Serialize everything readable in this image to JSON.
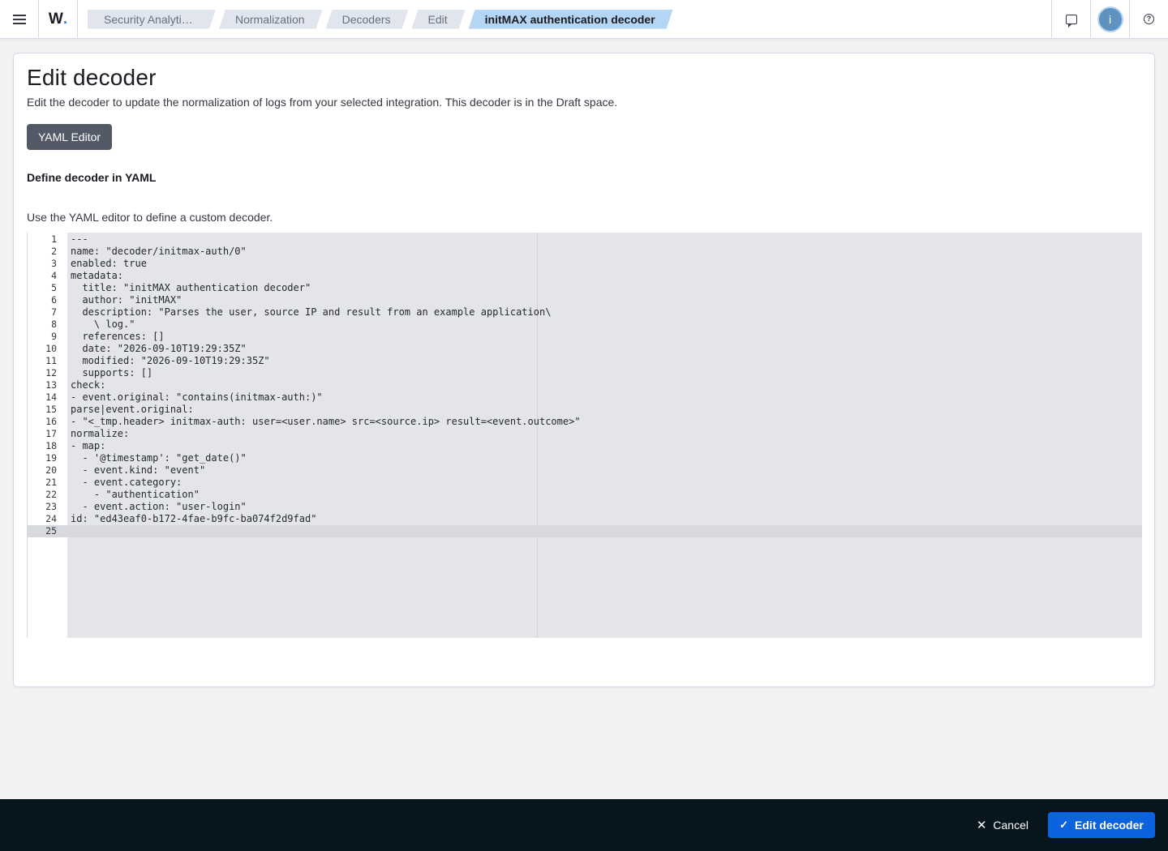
{
  "header": {
    "logo_text": "W",
    "logo_dot": ".",
    "breadcrumbs": [
      {
        "label": "Security Analyti…"
      },
      {
        "label": "Normalization"
      },
      {
        "label": "Decoders"
      },
      {
        "label": "Edit"
      },
      {
        "label": "initMAX authentication decoder"
      }
    ],
    "avatar_initial": "i",
    "help_glyph": "?"
  },
  "page": {
    "title": "Edit decoder",
    "description": "Edit the decoder to update the normalization of logs from your selected integration. This decoder is in the Draft space.",
    "yaml_button_label": "YAML Editor",
    "section_title": "Define decoder in YAML",
    "section_description": "Use the YAML editor to define a custom decoder."
  },
  "editor": {
    "lines": [
      {
        "n": "1",
        "text": "---"
      },
      {
        "n": "2",
        "text": "name: \"decoder/initmax-auth/0\""
      },
      {
        "n": "3",
        "text": "enabled: true"
      },
      {
        "n": "4",
        "text": "metadata:"
      },
      {
        "n": "5",
        "text": "  title: \"initMAX authentication decoder\""
      },
      {
        "n": "6",
        "text": "  author: \"initMAX\""
      },
      {
        "n": "7",
        "text": "  description: \"Parses the user, source IP and result from an example application\\"
      },
      {
        "n": "8",
        "text": "    \\ log.\""
      },
      {
        "n": "9",
        "text": "  references: []"
      },
      {
        "n": "10",
        "text": "  date: \"2026-09-10T19:29:35Z\""
      },
      {
        "n": "11",
        "text": "  modified: \"2026-09-10T19:29:35Z\""
      },
      {
        "n": "12",
        "text": "  supports: []"
      },
      {
        "n": "13",
        "text": "check:"
      },
      {
        "n": "14",
        "text": "- event.original: \"contains(initmax-auth:)\""
      },
      {
        "n": "15",
        "text": "parse|event.original:"
      },
      {
        "n": "16",
        "text": "- \"<_tmp.header> initmax-auth: user=<user.name> src=<source.ip> result=<event.outcome>\""
      },
      {
        "n": "17",
        "text": "normalize:"
      },
      {
        "n": "18",
        "text": "- map:"
      },
      {
        "n": "19",
        "text": "  - '@timestamp': \"get_date()\""
      },
      {
        "n": "20",
        "text": "  - event.kind: \"event\""
      },
      {
        "n": "21",
        "text": "  - event.category:"
      },
      {
        "n": "22",
        "text": "    - \"authentication\""
      },
      {
        "n": "23",
        "text": "  - event.action: \"user-login\""
      },
      {
        "n": "24",
        "text": "id: \"ed43eaf0-b172-4fae-b9fc-ba074f2d9fad\""
      },
      {
        "n": "25",
        "text": ""
      }
    ],
    "active_line": "25"
  },
  "footer": {
    "cancel_label": "Cancel",
    "save_label": "Edit decoder"
  }
}
